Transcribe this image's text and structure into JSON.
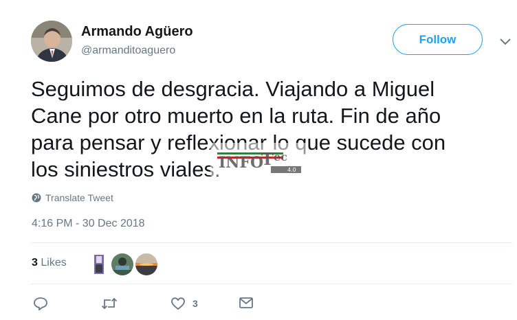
{
  "author": {
    "name": "Armando Agüero",
    "handle": "@armanditoaguero"
  },
  "follow_label": "Follow",
  "tweet": {
    "text": "Seguimos de desgracia. Viajando a Miguel\nCane por otro muerto en la ruta. Fin de año\npara pensar y reflexionar lo que sucede con\nlos siniestros viales."
  },
  "watermark": {
    "brand": "INFOTec",
    "version": "4.0"
  },
  "translate_label": "Translate Tweet",
  "timestamp": "4:16 PM - 30 Dec 2018",
  "likes": {
    "count": "3",
    "label": "Likes"
  },
  "actions": {
    "reply_count": "",
    "retweet_count": "",
    "like_count": "3"
  },
  "colors": {
    "accent": "#1da1f2",
    "text_primary": "#14171a",
    "text_secondary": "#657786",
    "divider": "#e6ecf0"
  },
  "icons": [
    "chevron-down-icon",
    "globe-icon",
    "reply-icon",
    "retweet-icon",
    "heart-icon",
    "message-icon"
  ]
}
